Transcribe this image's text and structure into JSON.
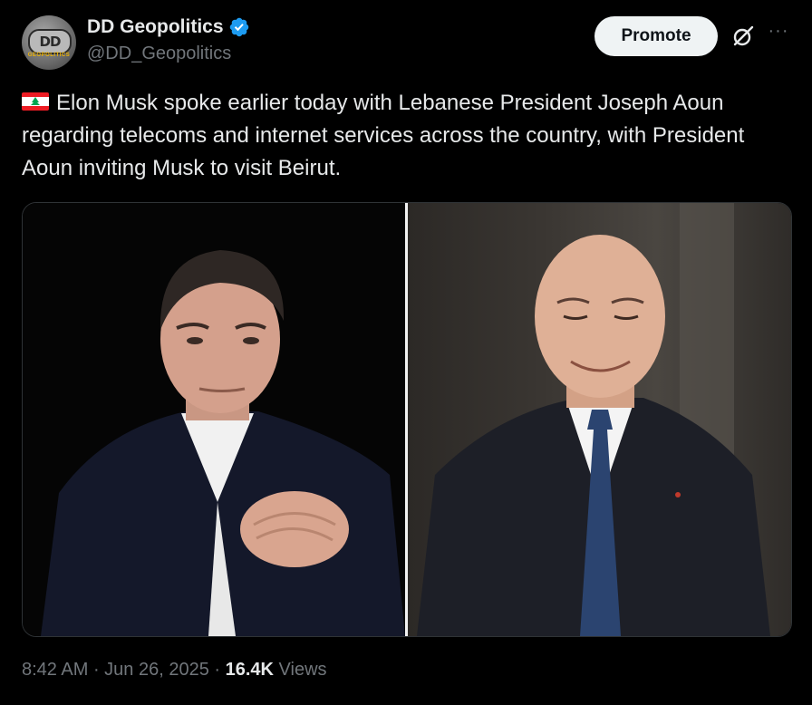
{
  "author": {
    "display_name": "DD Geopolitics",
    "handle": "@DD_Geopolitics",
    "avatar_mark": "DD",
    "avatar_sub": "GEOPOLITICS",
    "verified": true,
    "verified_color": "#1d9bf0"
  },
  "actions": {
    "promote_label": "Promote",
    "grok_icon": "grok-icon",
    "more_label": "···"
  },
  "tweet": {
    "flag": "lebanon-flag-icon",
    "text": "Elon Musk spoke earlier today with Lebanese President Joseph Aoun regarding telecoms and internet services across the country, with President Aoun inviting Musk to visit Beirut."
  },
  "media": {
    "left_photo": "portrait-man-dark-suit-hands-clasped",
    "right_photo": "portrait-bald-man-suit-blue-tie"
  },
  "meta": {
    "time": "8:42 AM",
    "sep1": " · ",
    "date": "Jun 26, 2025",
    "sep2": " · ",
    "views_count": "16.4K",
    "views_label": " Views"
  },
  "colors": {
    "background": "#000000",
    "text_primary": "#e7e9ea",
    "text_secondary": "#71767b",
    "promote_bg": "#eff3f4"
  }
}
